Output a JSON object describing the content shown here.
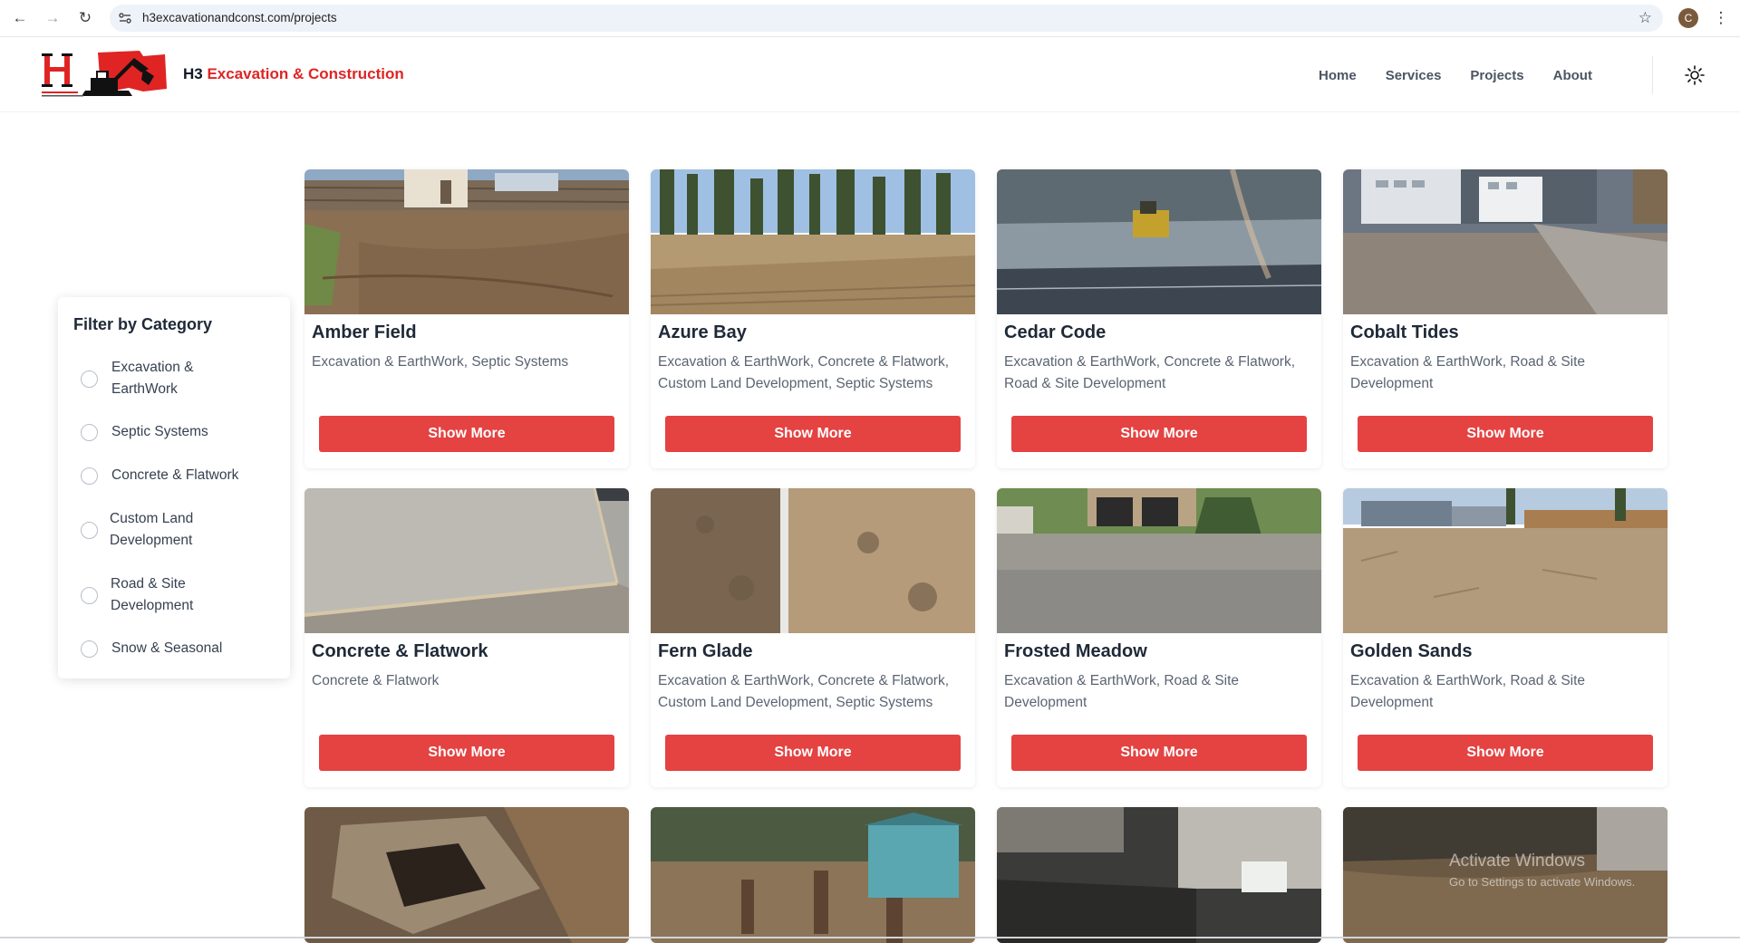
{
  "browser": {
    "url": "h3excavationandconst.com/projects",
    "profile_initial": "C",
    "icons": [
      "back-arrow-icon",
      "forward-arrow-icon",
      "reload-icon",
      "site-info-icon",
      "bookmark-star-icon",
      "more-vert-icon"
    ]
  },
  "header": {
    "brand_prefix": "H3",
    "brand_suffix": "Excavation & Construction",
    "nav": [
      "Home",
      "Services",
      "Projects",
      "About"
    ],
    "theme_icon": "sun-icon"
  },
  "filter": {
    "title": "Filter by Category",
    "options": [
      "Excavation & EarthWork",
      "Septic Systems",
      "Concrete & Flatwork",
      "Custom Land Development",
      "Road & Site Development",
      "Snow & Seasonal"
    ]
  },
  "projects": [
    {
      "title": "Amber Field",
      "categories": "Excavation & EarthWork, Septic Systems",
      "button": "Show More"
    },
    {
      "title": "Azure Bay",
      "categories": "Excavation & EarthWork, Concrete & Flatwork, Custom Land Development, Septic Systems",
      "button": "Show More"
    },
    {
      "title": "Cedar Code",
      "categories": "Excavation & EarthWork, Concrete & Flatwork, Road & Site Development",
      "button": "Show More"
    },
    {
      "title": "Cobalt Tides",
      "categories": "Excavation & EarthWork, Road & Site Development",
      "button": "Show More"
    },
    {
      "title": "Concrete & Flatwork",
      "categories": "Concrete & Flatwork",
      "button": "Show More"
    },
    {
      "title": "Fern Glade",
      "categories": "Excavation & EarthWork, Concrete & Flatwork, Custom Land Development, Septic Systems",
      "button": "Show More"
    },
    {
      "title": "Frosted Meadow",
      "categories": "Excavation & EarthWork, Road & Site Development",
      "button": "Show More"
    },
    {
      "title": "Golden Sands",
      "categories": "Excavation & EarthWork, Road & Site Development",
      "button": "Show More"
    },
    {
      "title": "",
      "categories": "",
      "button": ""
    },
    {
      "title": "",
      "categories": "",
      "button": ""
    },
    {
      "title": "",
      "categories": "",
      "button": ""
    },
    {
      "title": "",
      "categories": "",
      "button": ""
    }
  ],
  "watermark": {
    "line1": "Activate Windows",
    "line2": "Go to Settings to activate Windows."
  },
  "colors": {
    "brand_red": "#e02424",
    "button_red": "#e54242"
  }
}
